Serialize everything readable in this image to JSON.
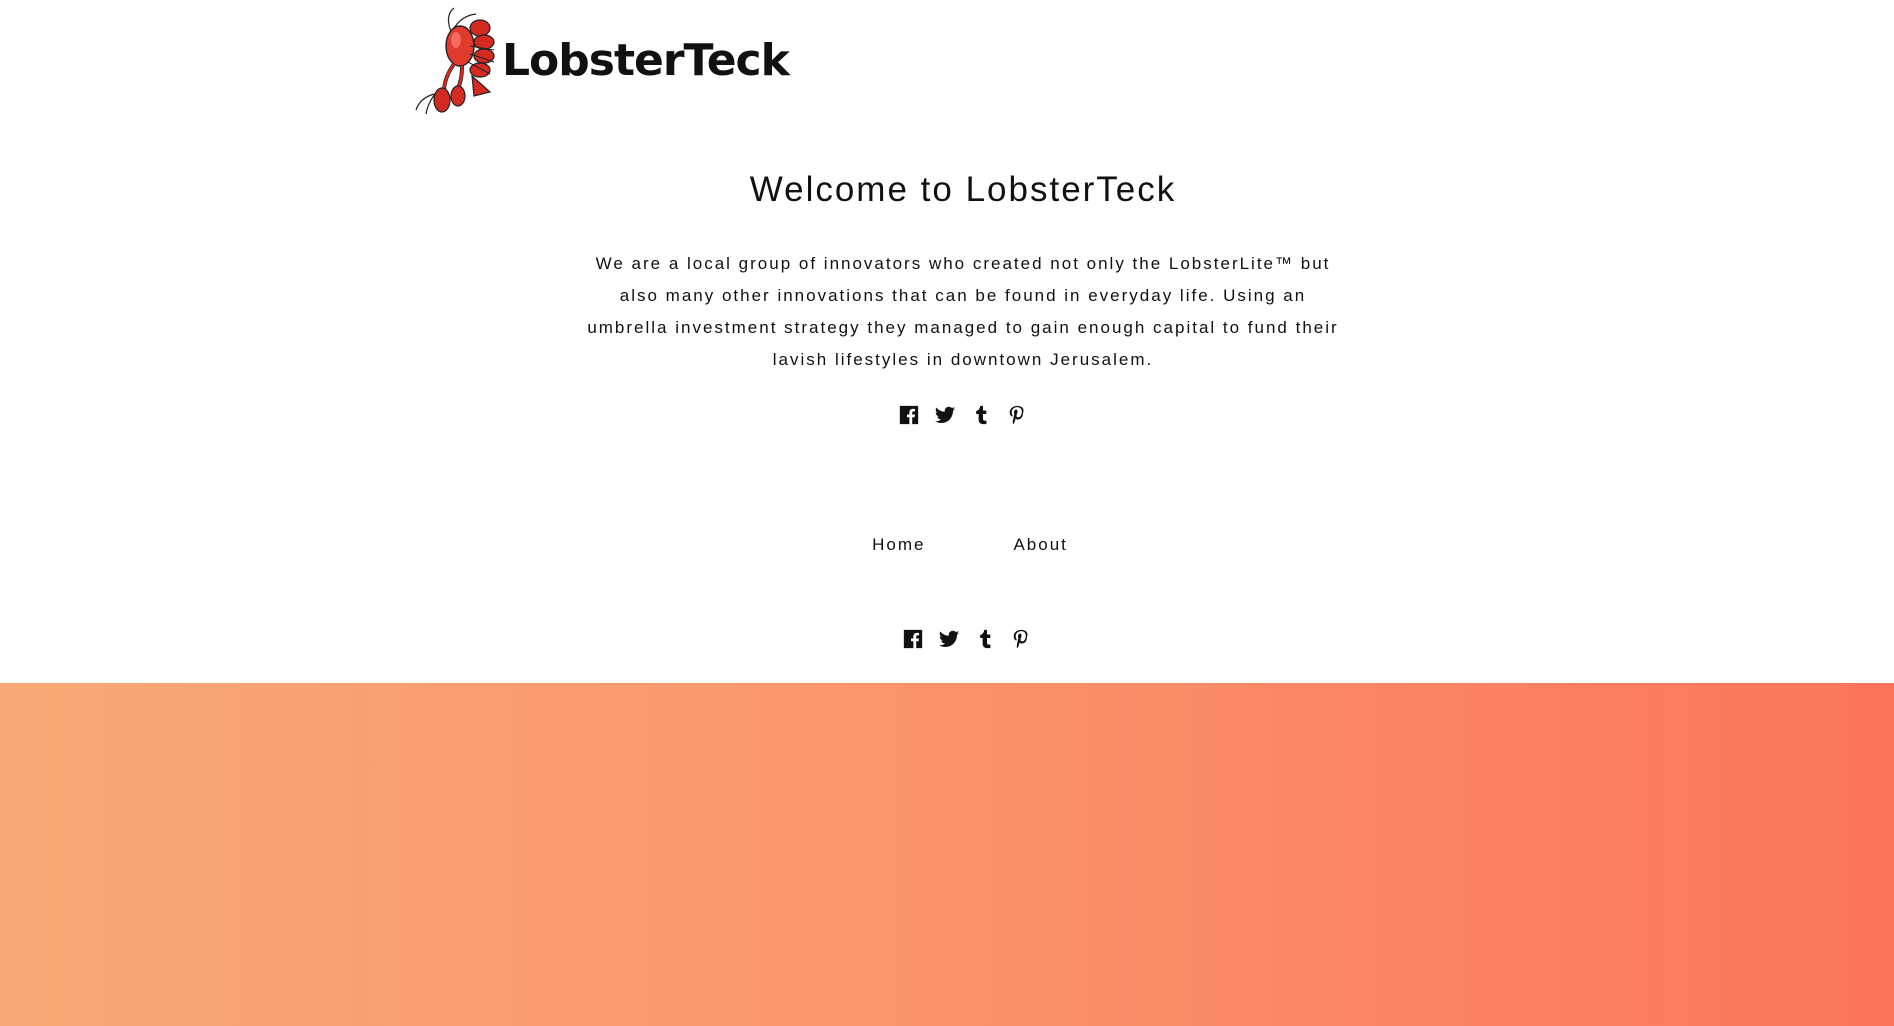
{
  "header": {
    "logo_text": "LobsterTeck",
    "logo_icon": "lobster-icon"
  },
  "hero": {
    "title": "Welcome to LobsterTeck",
    "body": "We are a local group of innovators who created not only the LobsterLite™ but also many other innovations that can be found in everyday life. Using an umbrella investment strategy they managed to gain enough capital to fund their lavish lifestyles in downtown Jerusalem."
  },
  "social": {
    "icons": [
      "facebook-icon",
      "twitter-icon",
      "tumblr-icon",
      "pinterest-icon"
    ]
  },
  "nav": {
    "home_label": "Home",
    "about_label": "About"
  },
  "colors": {
    "gradient_start": "#f9a977",
    "gradient_end": "#fb755c",
    "lobster_red": "#d42a22"
  }
}
